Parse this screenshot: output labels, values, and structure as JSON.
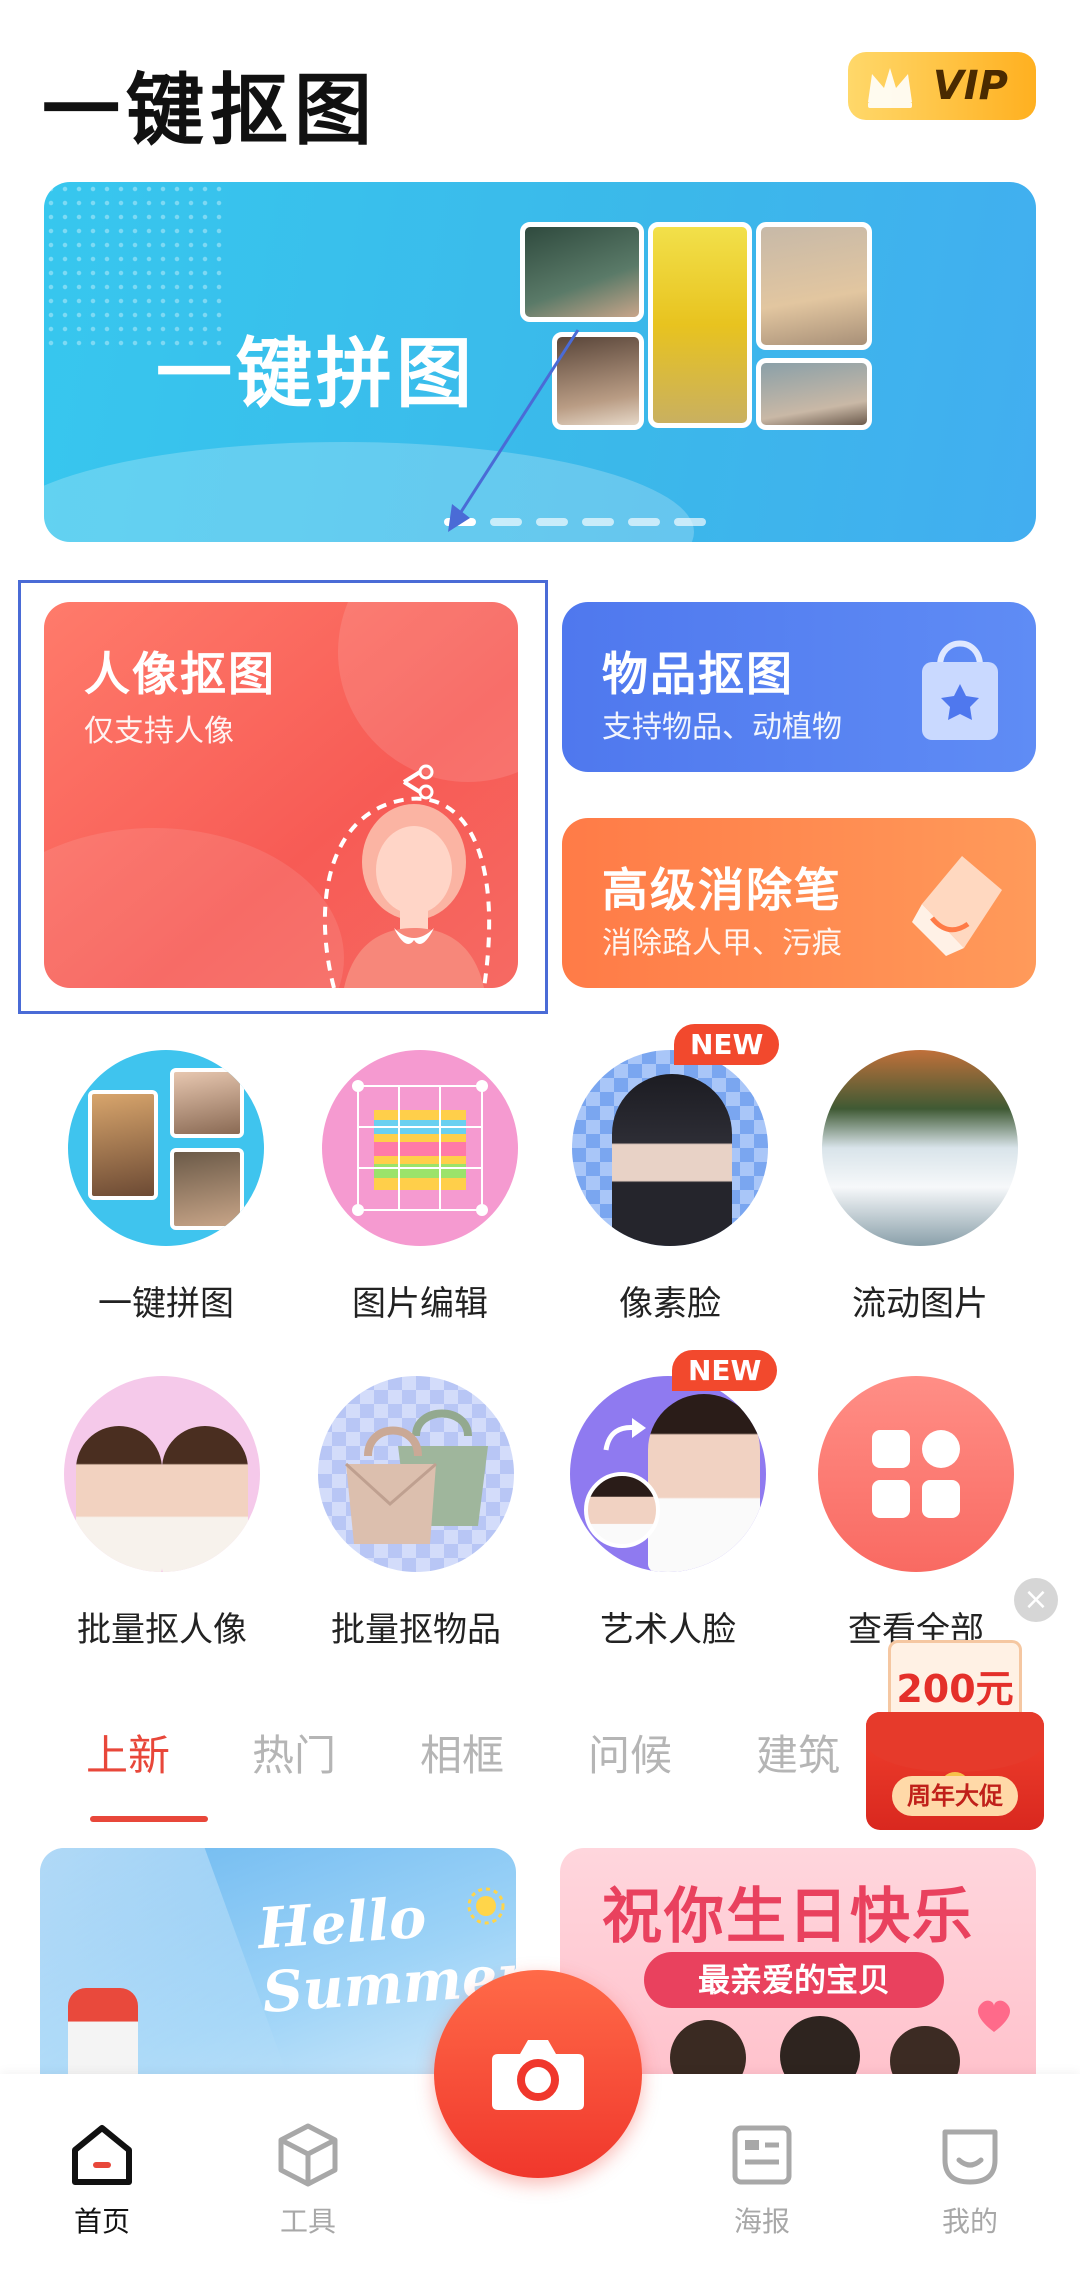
{
  "header": {
    "app_title": "一键抠图",
    "vip_label": "VIP"
  },
  "banner": {
    "title": "一键拼图",
    "pages": 6,
    "active_page": 1
  },
  "features": {
    "portrait": {
      "title": "人像抠图",
      "subtitle": "仅支持人像"
    },
    "object": {
      "title": "物品抠图",
      "subtitle": "支持物品、动植物"
    },
    "eraser": {
      "title": "高级消除笔",
      "subtitle": "消除路人甲、污痕"
    }
  },
  "tools": [
    {
      "label": "一键拼图"
    },
    {
      "label": "图片编辑"
    },
    {
      "label": "像素脸",
      "badge": "NEW"
    },
    {
      "label": "流动图片"
    },
    {
      "label": "批量抠人像"
    },
    {
      "label": "批量抠物品"
    },
    {
      "label": "艺术人脸",
      "badge": "NEW"
    },
    {
      "label": "查看全部"
    }
  ],
  "promo": {
    "amount": "200元",
    "label": "周年大促",
    "close": "×"
  },
  "tabs": [
    {
      "label": "上新",
      "active": true
    },
    {
      "label": "热门"
    },
    {
      "label": "相框"
    },
    {
      "label": "问候"
    },
    {
      "label": "建筑"
    }
  ],
  "content_cards": {
    "summer": {
      "text_line1": "Hello",
      "text_line2": "Summer"
    },
    "birthday": {
      "title": "祝你生日快乐",
      "subtitle": "最亲爱的宝贝"
    }
  },
  "bottom_nav": [
    {
      "label": "首页",
      "icon": "home-icon",
      "active": true
    },
    {
      "label": "工具",
      "icon": "tools-cube-icon"
    },
    {
      "label": "",
      "icon": "camera-icon"
    },
    {
      "label": "海报",
      "icon": "poster-icon"
    },
    {
      "label": "我的",
      "icon": "profile-smile-icon"
    }
  ],
  "colors": {
    "accent_red": "#e8473a",
    "banner_blue": "#37c7ee",
    "portrait_card": "#f75b55",
    "object_card": "#4f78ee",
    "eraser_card": "#ff7b47",
    "annotation_blue": "#4a6bd6"
  }
}
